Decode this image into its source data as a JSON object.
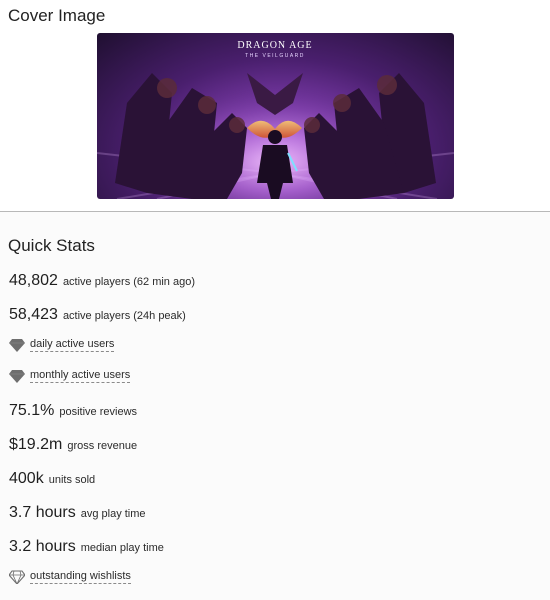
{
  "cover": {
    "section_title": "Cover Image",
    "logo_line1": "DRAGON AGE",
    "logo_line2": "THE VEILGUARD"
  },
  "quick_stats": {
    "section_title": "Quick Stats",
    "stats": [
      {
        "value": "48,802",
        "label": "active players (62 min ago)"
      },
      {
        "value": "58,423",
        "label": "active players (24h peak)"
      },
      {
        "icon": "gem-filled-icon",
        "label": "daily active users"
      },
      {
        "icon": "gem-filled-icon",
        "label": "monthly active users"
      },
      {
        "value": "75.1%",
        "label": "positive reviews"
      },
      {
        "value": "$19.2m",
        "label": "gross revenue"
      },
      {
        "value": "400k",
        "label": "units sold"
      },
      {
        "value": "3.7 hours",
        "label": "avg play time"
      },
      {
        "value": "3.2 hours",
        "label": "median play time"
      },
      {
        "icon": "gem-outline-icon",
        "label": "outstanding wishlists"
      }
    ]
  },
  "colors": {
    "cover_purple": "#7a3aa8",
    "divider": "#b8b8b8",
    "gem_fill": "#6e6e6e"
  }
}
